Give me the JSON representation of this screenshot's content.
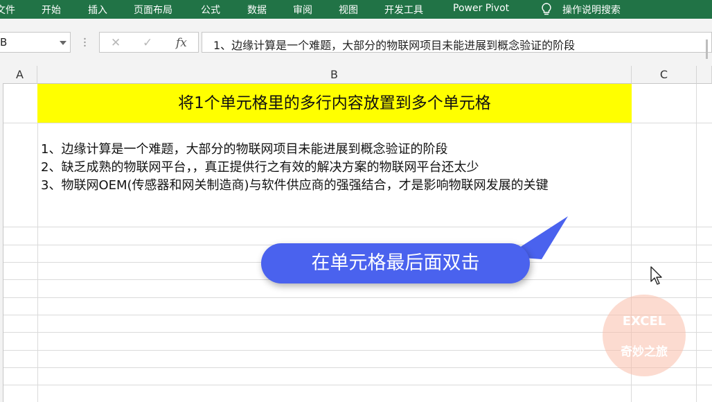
{
  "ribbon": {
    "tabs": [
      "文件",
      "开始",
      "插入",
      "页面布局",
      "公式",
      "数据",
      "审阅",
      "视图",
      "开发工具",
      "Power Pivot",
      "操作说明搜索"
    ]
  },
  "name_box": {
    "value": "B"
  },
  "formula_bar": {
    "cancel_icon": "✕",
    "enter_icon": "✓",
    "fx_icon": "fx",
    "value": "1、边缘计算是一个难题，大部分的物联网项目未能进展到概念验证的阶段"
  },
  "columns": [
    "A",
    "B",
    "C"
  ],
  "sheet": {
    "title_cell": "将1个单元格里的多行内容放置到多个单元格",
    "content_lines": [
      "1、边缘计算是一个难题，大部分的物联网项目未能进展到概念验证的阶段",
      "2、缺乏成熟的物联网平台，，真正提供行之有效的解决方案的物联网平台还太少",
      "3、物联网OEM(传感器和网关制造商)与软件供应商的强强结合，才是影响物联网发展的关键"
    ]
  },
  "callout": {
    "text": "在单元格最后面双击",
    "color": "#4a62ee"
  },
  "watermark": {
    "line1": "EXCEL",
    "line2": "奇妙之旅"
  },
  "colors": {
    "ribbon": "#217346",
    "title_fill": "#ffff00"
  }
}
